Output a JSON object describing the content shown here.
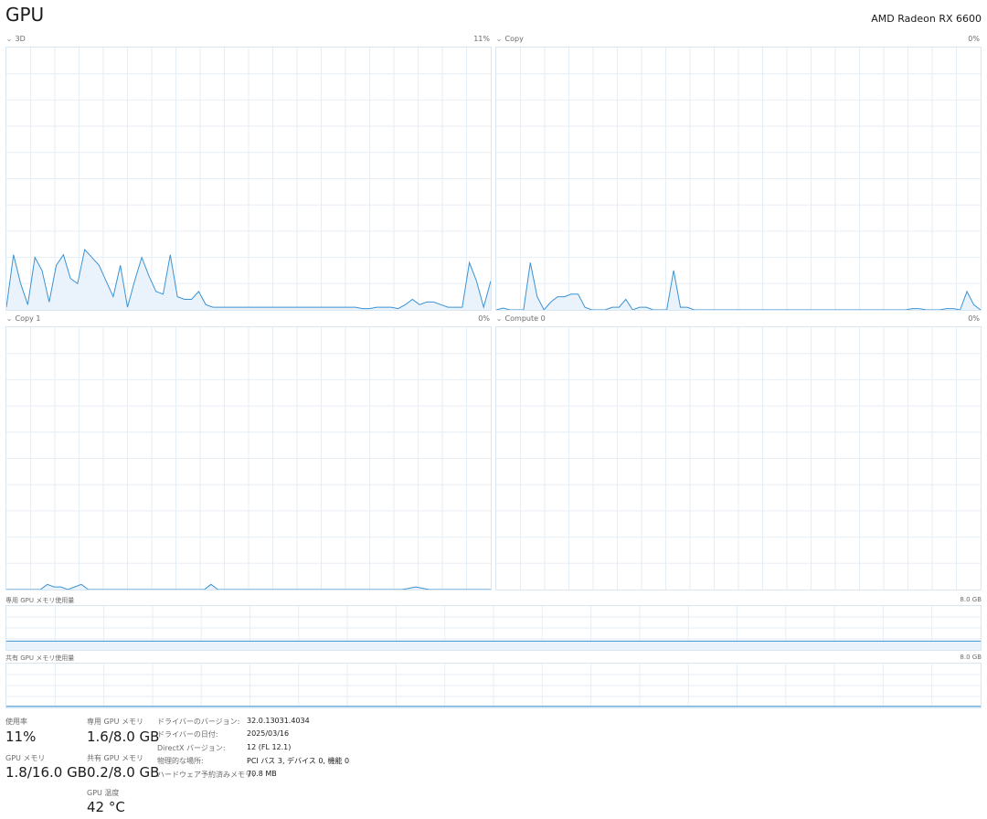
{
  "header": {
    "title": "GPU",
    "device_name": "AMD Radeon RX 6600"
  },
  "engines": [
    {
      "label": "3D",
      "percent": "11%",
      "values": [
        1,
        21,
        10,
        2,
        20,
        15,
        3,
        17,
        21,
        12,
        10,
        23,
        20,
        17,
        11,
        5,
        17,
        1,
        11,
        20,
        13,
        7,
        6,
        21,
        5,
        4,
        4,
        7,
        2,
        1,
        1,
        1,
        1,
        1,
        1,
        1,
        1,
        1,
        1,
        1,
        1,
        1,
        1,
        1,
        1,
        1,
        1,
        1,
        1,
        1,
        0.5,
        0.5,
        1,
        1,
        1,
        0.5,
        2,
        4,
        2,
        3,
        3,
        2,
        1,
        1,
        1,
        18,
        11,
        1,
        11
      ]
    },
    {
      "label": "Copy",
      "percent": "0%",
      "values": [
        0,
        0.7,
        0,
        0,
        0,
        18,
        5,
        0,
        3,
        5,
        5,
        6,
        6,
        1,
        0,
        0,
        0,
        1,
        1,
        4,
        0,
        1,
        1,
        0,
        0,
        0,
        15,
        1,
        1,
        0,
        0,
        0,
        0,
        0,
        0,
        0,
        0,
        0,
        0,
        0,
        0,
        0,
        0,
        0,
        0,
        0,
        0,
        0,
        0,
        0,
        0,
        0,
        0,
        0,
        0,
        0,
        0,
        0,
        0,
        0,
        0,
        0.5,
        0.5,
        0,
        0,
        0,
        0.5,
        0.5,
        0,
        7,
        2,
        0
      ]
    },
    {
      "label": "Copy 1",
      "percent": "0%",
      "values": [
        0,
        0,
        0,
        0,
        0,
        0,
        2,
        1,
        1,
        0,
        1,
        2,
        0,
        0,
        0,
        0,
        0,
        0,
        0,
        0,
        0,
        0,
        0,
        0,
        0,
        0,
        0,
        0,
        0,
        0,
        2,
        0,
        0,
        0,
        0,
        0,
        0,
        0,
        0,
        0,
        0,
        0,
        0,
        0,
        0,
        0,
        0,
        0,
        0,
        0,
        0,
        0,
        0,
        0,
        0,
        0,
        0,
        0,
        0,
        0.5,
        1,
        0.5,
        0,
        0,
        0,
        0,
        0,
        0,
        0,
        0,
        0,
        0
      ]
    },
    {
      "label": "Compute 0",
      "percent": "0%",
      "values": []
    }
  ],
  "memory_charts": {
    "dedicated": {
      "label": "専用 GPU メモリ使用量",
      "capacity": "8.0 GB",
      "fraction": 0.2
    },
    "shared": {
      "label": "共有 GPU メモリ使用量",
      "capacity": "8.0 GB",
      "fraction": 0.025
    }
  },
  "stats": {
    "utilization_label": "使用率",
    "utilization_value": "11%",
    "gpu_memory_label": "GPU メモリ",
    "gpu_memory_value": "1.8/16.0 GB",
    "dedicated_label": "専用 GPU メモリ",
    "dedicated_value": "1.6/8.0 GB",
    "shared_label": "共有 GPU メモリ",
    "shared_value": "0.2/8.0 GB",
    "temp_label": "GPU 温度",
    "temp_value": "42 °C"
  },
  "info": {
    "driver_version_label": "ドライバーのバージョン:",
    "driver_version_value": "32.0.13031.4034",
    "driver_date_label": "ドライバーの日付:",
    "driver_date_value": "2025/03/16",
    "directx_label": "DirectX バージョン:",
    "directx_value": "12 (FL 12.1)",
    "location_label": "物理的な場所:",
    "location_value": "PCI バス 3, デバイス 0, 機能 0",
    "reserved_label": "ハードウェア予約済みメモリ:",
    "reserved_value": "70.8 MB"
  },
  "colors": {
    "line": "#3a93d4",
    "fill": "#eaf3fb",
    "grid": "#e6eef5",
    "border": "#d8e6f2"
  }
}
